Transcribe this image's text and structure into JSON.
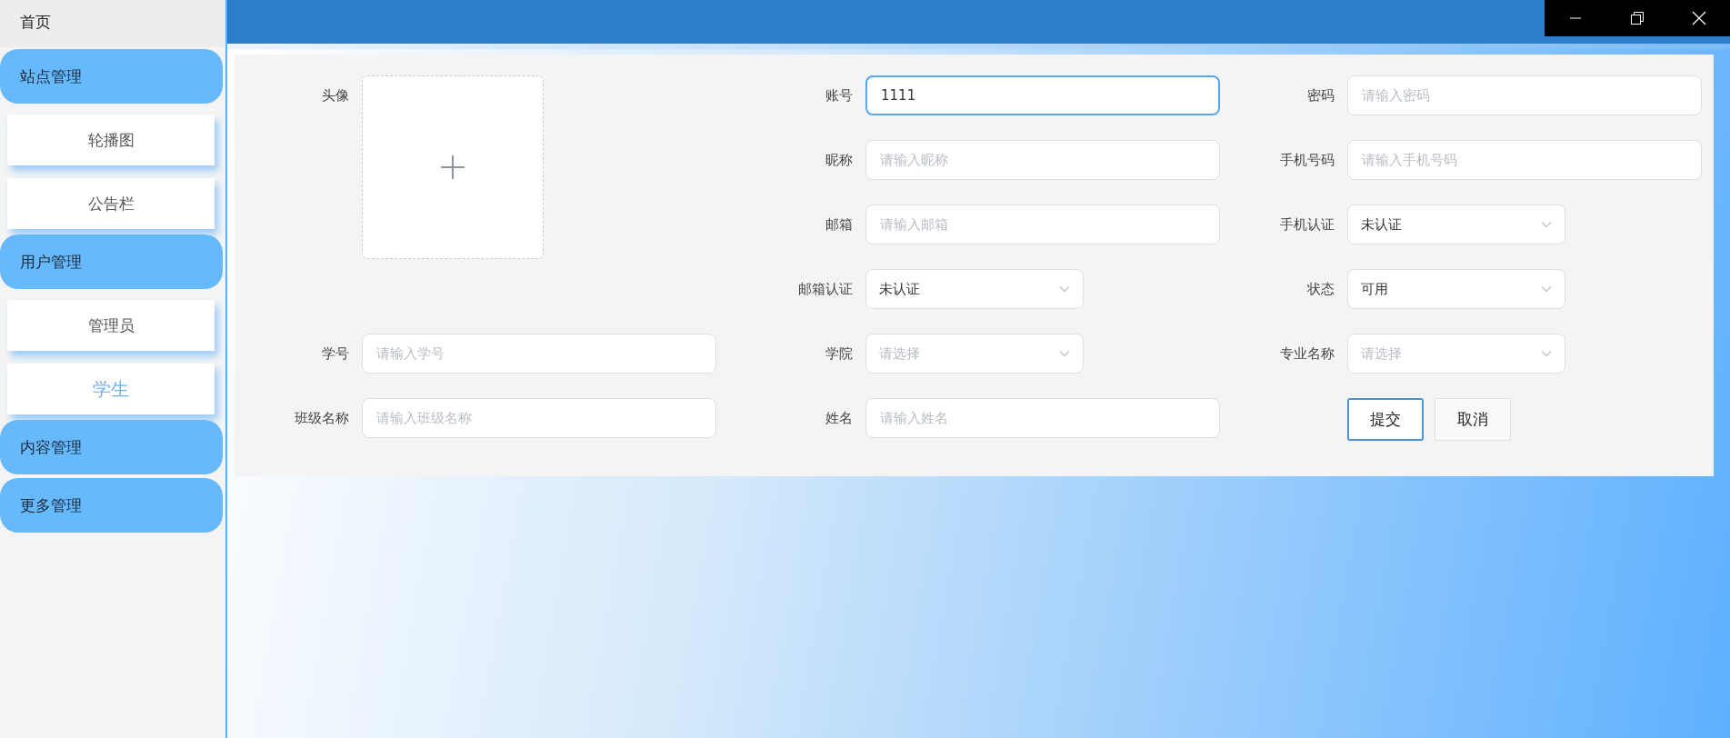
{
  "sidebar": {
    "home": "首页",
    "groups": [
      {
        "label": "站点管理",
        "children": [
          {
            "label": "轮播图",
            "selected": false
          },
          {
            "label": "公告栏",
            "selected": false
          }
        ]
      },
      {
        "label": "用户管理",
        "children": [
          {
            "label": "管理员",
            "selected": false
          },
          {
            "label": "学生",
            "selected": true
          }
        ]
      },
      {
        "label": "内容管理"
      },
      {
        "label": "更多管理"
      }
    ]
  },
  "form": {
    "columns": [
      [
        {
          "kind": "upload",
          "label": "头像"
        },
        {
          "kind": "input",
          "label": "学号",
          "placeholder": "请输入学号",
          "focused": false
        },
        {
          "kind": "input",
          "label": "班级名称",
          "placeholder": "请输入班级名称",
          "focused": false
        }
      ],
      [
        {
          "kind": "input",
          "label": "账号",
          "value": "1111",
          "focused": true
        },
        {
          "kind": "input",
          "label": "昵称",
          "placeholder": "请输入昵称",
          "focused": false
        },
        {
          "kind": "input",
          "label": "邮箱",
          "placeholder": "请输入邮箱",
          "focused": false
        },
        {
          "kind": "select",
          "label": "邮箱认证",
          "value": "未认证",
          "focused": false
        },
        {
          "kind": "select",
          "label": "学院",
          "placeholder": "请选择",
          "focused": false
        },
        {
          "kind": "input",
          "label": "姓名",
          "placeholder": "请输入姓名",
          "focused": false
        }
      ],
      [
        {
          "kind": "input",
          "label": "密码",
          "placeholder": "请输入密码",
          "focused": false
        },
        {
          "kind": "input",
          "label": "手机号码",
          "placeholder": "请输入手机号码",
          "focused": false
        },
        {
          "kind": "select",
          "label": "手机认证",
          "value": "未认证",
          "focused": false
        },
        {
          "kind": "select",
          "label": "状态",
          "value": "可用",
          "focused": false
        },
        {
          "kind": "select",
          "label": "专业名称",
          "placeholder": "请选择",
          "focused": false
        },
        {
          "kind": "buttons",
          "buttons": [
            {
              "label": "提交",
              "focused": true
            },
            {
              "label": "取消",
              "focused": false
            }
          ]
        }
      ]
    ]
  }
}
